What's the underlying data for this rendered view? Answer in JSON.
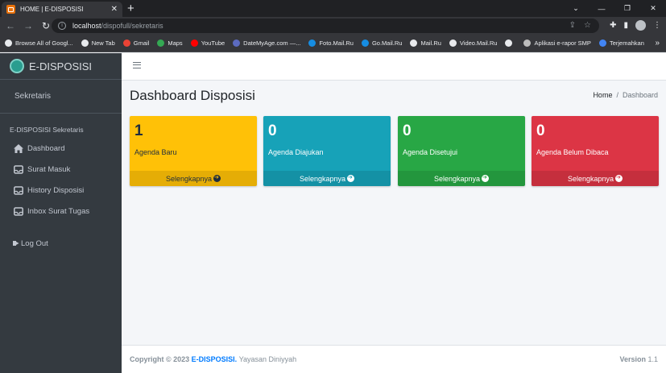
{
  "browser": {
    "tab_title": "HOME | E-DISPOSISI",
    "url_host": "localhost",
    "url_path": "/dispofull/sekretaris",
    "bookmarks": [
      {
        "label": "Browse All of Googl...",
        "color": "#e8eaed"
      },
      {
        "label": "New Tab",
        "color": "#e8eaed"
      },
      {
        "label": "Gmail",
        "color": "#ea4335"
      },
      {
        "label": "Maps",
        "color": "#34a853"
      },
      {
        "label": "YouTube",
        "color": "#ff0000"
      },
      {
        "label": "DateMyAge.com —...",
        "color": "#5c6bc0"
      },
      {
        "label": "Foto.Mail.Ru",
        "color": "#168de2"
      },
      {
        "label": "Go.Mail.Ru",
        "color": "#168de2"
      },
      {
        "label": "Mail.Ru",
        "color": "#e8eaed"
      },
      {
        "label": "Video.Mail.Ru",
        "color": "#e8eaed"
      },
      {
        "label": "",
        "color": "#e8eaed"
      },
      {
        "label": "Aplikasi e-rapor SMP",
        "color": "#bdbdbd"
      },
      {
        "label": "Terjemahkan",
        "color": "#4285f4"
      }
    ]
  },
  "sidebar": {
    "brand": "E-DISPOSISI",
    "user": "Sekretaris",
    "header": "E-DISPOSISI Sekretaris",
    "items": [
      {
        "label": "Dashboard",
        "icon": "home-icon"
      },
      {
        "label": "Surat Masuk",
        "icon": "inbox-icon"
      },
      {
        "label": "History Disposisi",
        "icon": "inbox-icon"
      },
      {
        "label": "Inbox Surat Tugas",
        "icon": "inbox-icon"
      }
    ],
    "logout": "Log Out"
  },
  "page": {
    "title": "Dashboard Disposisi",
    "breadcrumb": {
      "home": "Home",
      "separator": "/",
      "active": "Dashboard"
    }
  },
  "boxes": [
    {
      "value": "1",
      "label": "Agenda Baru",
      "footer": "Selengkapnya",
      "color": "#ffc107"
    },
    {
      "value": "0",
      "label": "Agenda Diajukan",
      "footer": "Selengkapnya",
      "color": "#17a2b8"
    },
    {
      "value": "0",
      "label": "Agenda Disetujui",
      "footer": "Selengkapnya",
      "color": "#28a745"
    },
    {
      "value": "0",
      "label": "Agenda Belum Dibaca",
      "footer": "Selengkapnya",
      "color": "#dc3545"
    }
  ],
  "footer": {
    "copyright": "Copyright © 2023",
    "brand": "E-DISPOSISI.",
    "org": "Yayasan Diniyyah",
    "version_label": "Version",
    "version": "1.1"
  }
}
